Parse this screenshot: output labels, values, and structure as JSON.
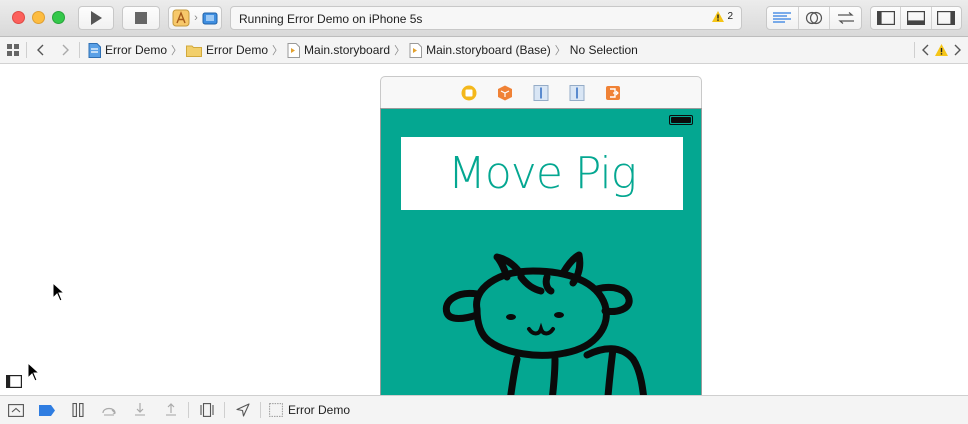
{
  "toolbar": {
    "activity_text": "Running Error Demo on iPhone 5s",
    "warning_count": "2",
    "scheme_icons": [
      "app-target-icon",
      "simulator-icon"
    ]
  },
  "jumpbar": {
    "crumbs": [
      {
        "label": "Error Demo",
        "icon": "project-icon"
      },
      {
        "label": "Error Demo",
        "icon": "folder-icon"
      },
      {
        "label": "Main.storyboard",
        "icon": "storyboard-icon"
      },
      {
        "label": "Main.storyboard (Base)",
        "icon": "storyboard-icon"
      },
      {
        "label": "No Selection",
        "icon": ""
      }
    ]
  },
  "canvas": {
    "title_label": "Move Pig"
  },
  "debugbar": {
    "process_name": "Error Demo"
  },
  "colors": {
    "scene_background": "#04a791",
    "title_text": "#04a791",
    "breakpoint_active": "#2f7de1",
    "warning": "#f5c518"
  }
}
